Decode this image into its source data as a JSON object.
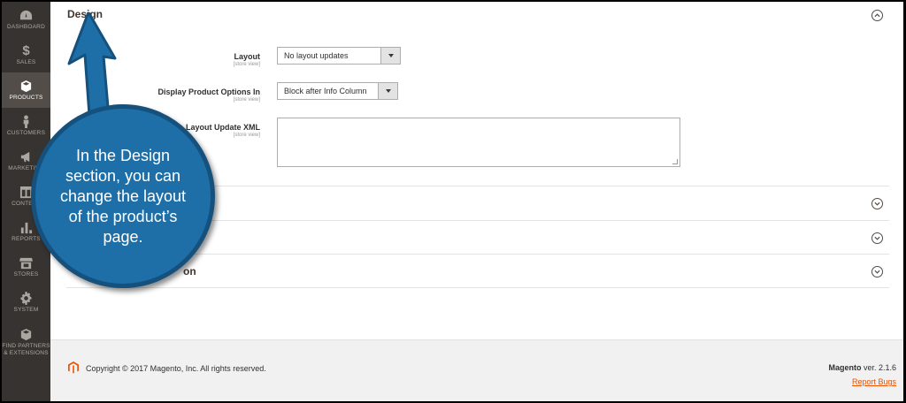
{
  "sidebar": {
    "items": [
      {
        "label": "DASHBOARD",
        "icon": "dashboard-icon"
      },
      {
        "label": "SALES",
        "icon": "dollar-icon"
      },
      {
        "label": "PRODUCTS",
        "icon": "box-icon",
        "active": true
      },
      {
        "label": "CUSTOMERS",
        "icon": "person-icon"
      },
      {
        "label": "MARKETING",
        "icon": "megaphone-icon"
      },
      {
        "label": "CONTENT",
        "icon": "layout-icon"
      },
      {
        "label": "REPORTS",
        "icon": "bar-chart-icon"
      },
      {
        "label": "STORES",
        "icon": "store-icon"
      },
      {
        "label": "SYSTEM",
        "icon": "gear-icon"
      },
      {
        "label": "FIND PARTNERS & EXTENSIONS",
        "icon": "extensions-icon"
      }
    ]
  },
  "design": {
    "title": "Design",
    "layout_label": "Layout",
    "layout_scope": "[store view]",
    "layout_value": "No layout updates",
    "options_label": "Display Product Options In",
    "options_scope": "[store view]",
    "options_value": "Block after Info Column",
    "xml_label": "Layout Update XML",
    "xml_scope": "[store view]"
  },
  "collapsed_sections": {
    "partial_title": "on"
  },
  "footer": {
    "copyright": "Copyright © 2017 Magento, Inc. All rights reserved.",
    "version_brand": "Magento",
    "version_text": " ver. 2.1.6",
    "report_bugs": "Report Bugs"
  },
  "callout": {
    "text": "In the Design section, you can change the layout of the product’s page."
  },
  "colors": {
    "sidebar_bg": "#373330",
    "accent": "#eb5202",
    "callout_fill": "#1e6fa8"
  }
}
